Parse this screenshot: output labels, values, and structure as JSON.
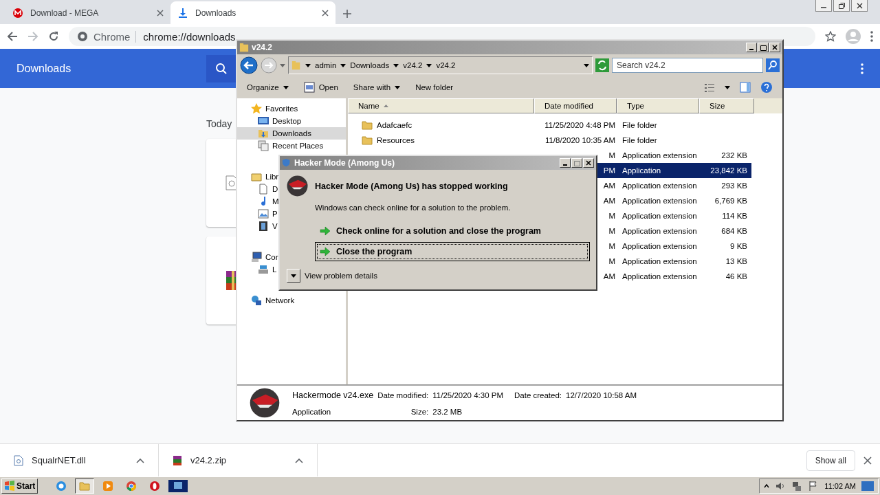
{
  "browser": {
    "tabs": [
      {
        "title": "Download - MEGA",
        "kind": "mega",
        "selected": false
      },
      {
        "title": "Downloads",
        "kind": "download",
        "selected": true
      }
    ],
    "omnibox": {
      "site": "Chrome",
      "url": "chrome://downloads"
    }
  },
  "downloads_page": {
    "title": "Downloads",
    "date_heading": "Today",
    "cards": [
      {
        "kind": "file"
      },
      {
        "kind": "archive"
      }
    ]
  },
  "explorer": {
    "title": "v24.2",
    "breadcrumb": [
      "admin",
      "Downloads",
      "v24.2",
      "v24.2"
    ],
    "search_placeholder": "Search v24.2",
    "toolbar": [
      {
        "label": "Organize",
        "kind": "menu"
      },
      {
        "label": "Open",
        "kind": "open"
      },
      {
        "label": "Share with",
        "kind": "menu"
      },
      {
        "label": "New folder",
        "kind": "plain"
      }
    ],
    "nav": [
      {
        "label": "Favorites",
        "kind": "star",
        "selected": false,
        "children": [
          {
            "label": "Desktop",
            "kind": "desktop",
            "selected": false
          },
          {
            "label": "Downloads",
            "kind": "downloads",
            "selected": true
          },
          {
            "label": "Recent Places",
            "kind": "recent",
            "selected": false
          }
        ]
      },
      {
        "label": "Libr",
        "kind": "library",
        "selected": false,
        "children": [
          {
            "label": "D",
            "kind": "document",
            "selected": false
          },
          {
            "label": "M",
            "kind": "music",
            "selected": false
          },
          {
            "label": "P",
            "kind": "pictures",
            "selected": false
          },
          {
            "label": "V",
            "kind": "video",
            "selected": false
          }
        ]
      },
      {
        "label": "Cor",
        "kind": "computer",
        "selected": false,
        "children": [
          {
            "label": "L",
            "kind": "disk",
            "selected": false
          }
        ]
      },
      {
        "label": "Network",
        "kind": "network",
        "selected": false
      }
    ],
    "columns": [
      "Name",
      "Date modified",
      "Type",
      "Size"
    ],
    "files": [
      {
        "name": "Adafcaefc",
        "kind": "folder",
        "date": "11/25/2020 4:48 PM",
        "type": "File folder",
        "selected": false
      },
      {
        "name": "Resources",
        "kind": "folder",
        "date": "11/8/2020 10:35 AM",
        "type": "File folder",
        "selected": false
      },
      {
        "date": "M",
        "type": "Application extension",
        "size": "232 KB",
        "selected": false
      },
      {
        "date": "PM",
        "type": "Application",
        "size": "23,842 KB",
        "selected": true
      },
      {
        "date": "AM",
        "type": "Application extension",
        "size": "293 KB",
        "selected": false
      },
      {
        "date": "AM",
        "type": "Application extension",
        "size": "6,769 KB",
        "selected": false
      },
      {
        "date": "M",
        "type": "Application extension",
        "size": "114 KB",
        "selected": false
      },
      {
        "date": "M",
        "type": "Application extension",
        "size": "684 KB",
        "selected": false
      },
      {
        "date": "M",
        "type": "Application extension",
        "size": "9 KB",
        "selected": false
      },
      {
        "date": "M",
        "type": "Application extension",
        "size": "13 KB",
        "selected": false
      },
      {
        "date": "AM",
        "type": "Application extension",
        "size": "46 KB",
        "selected": false
      }
    ],
    "details": {
      "name": "Hackermode v24.exe",
      "type": "Application",
      "modified_label": "Date modified:",
      "modified": "11/25/2020 4:30 PM",
      "size_label": "Size:",
      "size": "23.2 MB",
      "created_label": "Date created:",
      "created": "12/7/2020 10:58 AM"
    }
  },
  "dialog": {
    "title": "Hacker Mode (Among Us)",
    "heading": "Hacker Mode (Among Us) has stopped working",
    "message": "Windows can check online for a solution to the problem.",
    "actions": [
      {
        "label": "Check online for a solution and close the program",
        "selected": false
      },
      {
        "label": "Close the program",
        "selected": true
      }
    ],
    "details_toggle": "View problem details"
  },
  "shelf": {
    "items": [
      {
        "name": "SqualrNET.dll",
        "kind": "dll"
      },
      {
        "name": "v24.2.zip",
        "kind": "archive"
      }
    ],
    "show_all": "Show all"
  },
  "taskbar": {
    "start": "Start",
    "apps": [
      {
        "kind": "ie",
        "selected": false
      },
      {
        "kind": "explorer",
        "selected": true
      },
      {
        "kind": "media",
        "selected": false
      },
      {
        "kind": "chrome",
        "selected": false
      },
      {
        "kind": "opera",
        "selected": false
      },
      {
        "kind": "window",
        "selected": false
      }
    ],
    "clock": "11:02 AM"
  }
}
